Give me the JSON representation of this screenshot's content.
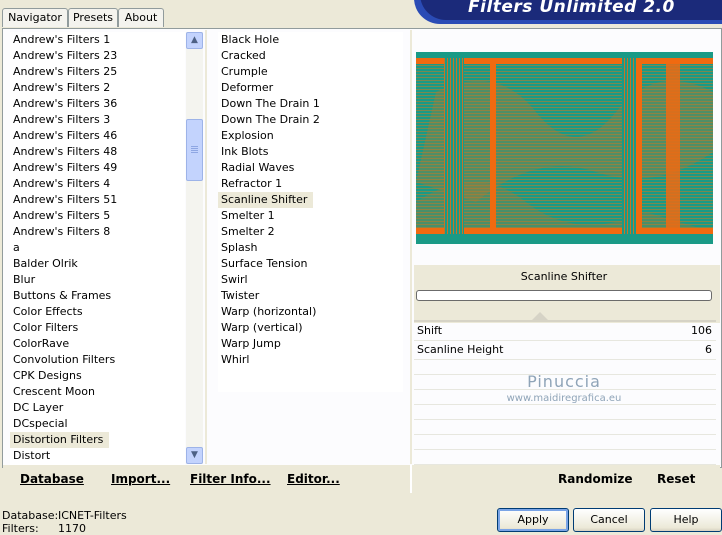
{
  "app": {
    "title": "Filters Unlimited 2.0"
  },
  "tabs": [
    {
      "label": "Navigator",
      "active": true
    },
    {
      "label": "Presets",
      "active": false
    },
    {
      "label": "About",
      "active": false
    }
  ],
  "categories": {
    "items": [
      "Andrew's Filters 1",
      "Andrew's Filters 23",
      "Andrew's Filters 25",
      "Andrew's Filters 2",
      "Andrew's Filters 36",
      "Andrew's Filters 3",
      "Andrew's Filters 46",
      "Andrew's Filters 48",
      "Andrew's Filters 49",
      "Andrew's Filters 4",
      "Andrew's Filters 51",
      "Andrew's Filters 5",
      "Andrew's Filters 8",
      "a",
      "Balder Olrik",
      "Blur",
      "Buttons & Frames",
      "Color Effects",
      "Color Filters",
      "ColorRave",
      "Convolution Filters",
      "CPK Designs",
      "Crescent Moon",
      "DC Layer",
      "DCspecial",
      "Distortion Filters",
      "Distort"
    ],
    "selected": "Distortion Filters"
  },
  "filters": {
    "items": [
      "Black Hole",
      "Cracked",
      "Crumple",
      "Deformer",
      "Down The Drain 1",
      "Down The Drain 2",
      "Explosion",
      "Ink Blots",
      "Radial Waves",
      "Refractor 1",
      "Scanline Shifter",
      "Smelter 1",
      "Smelter 2",
      "Splash",
      "Surface Tension",
      "Swirl",
      "Twister",
      "Warp (horizontal)",
      "Warp (vertical)",
      "Warp Jump",
      "Whirl"
    ],
    "selected": "Scanline Shifter"
  },
  "preview": {
    "filter_name": "Scanline Shifter",
    "colors": {
      "teal": "#1a9a86",
      "orange": "#f06a10"
    }
  },
  "params": [
    {
      "name": "Shift",
      "value": "106"
    },
    {
      "name": "Scanline Height",
      "value": "6"
    }
  ],
  "watermark": {
    "name": "Pinuccia",
    "url": "www.maidiregrafica.eu"
  },
  "toolbar": {
    "database": "Database",
    "import": "Import...",
    "filter_info": "Filter Info...",
    "editor": "Editor...",
    "randomize": "Randomize",
    "reset": "Reset"
  },
  "footer": {
    "database_label": "Database:",
    "database_value": "ICNET-Filters",
    "filters_label": "Filters:",
    "filters_value": "1170"
  },
  "buttons": {
    "apply": "Apply",
    "cancel": "Cancel",
    "help": "Help"
  }
}
